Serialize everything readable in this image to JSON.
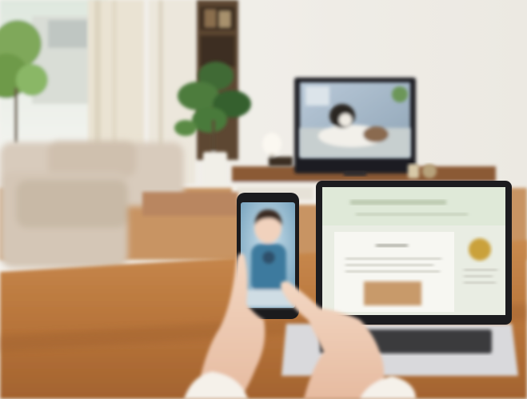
{
  "photo": {
    "colors": {
      "wall": "#efece6",
      "floor": "#c89464",
      "table": "#b9783d",
      "sofa": "#d8cbbc",
      "tv_frame": "#1f1f22",
      "laptop_screen": "#e9ede3",
      "phone_frame": "#1b1b1d",
      "plant": "#3f6b35"
    },
    "laptop_site": {
      "header_title": "",
      "article_title": "",
      "article_lines": ""
    }
  }
}
